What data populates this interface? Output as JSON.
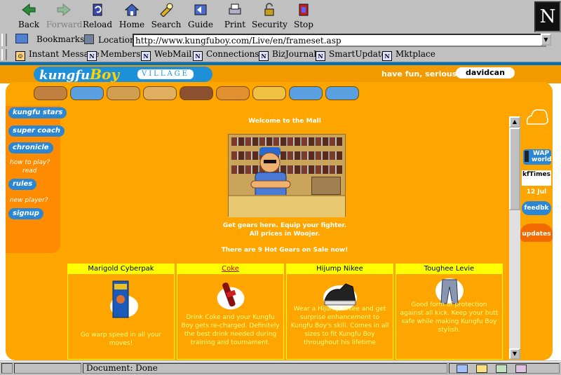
{
  "toolbar": {
    "buttons": [
      {
        "label": "Back",
        "icon": "back-arrow-icon"
      },
      {
        "label": "Forward",
        "icon": "forward-arrow-icon"
      },
      {
        "label": "Reload",
        "icon": "reload-icon"
      },
      {
        "label": "Home",
        "icon": "home-icon"
      },
      {
        "label": "Search",
        "icon": "search-flashlight-icon"
      },
      {
        "label": "Guide",
        "icon": "guide-icon"
      },
      {
        "label": "Print",
        "icon": "printer-icon"
      },
      {
        "label": "Security",
        "icon": "padlock-icon"
      },
      {
        "label": "Stop",
        "icon": "stop-icon"
      }
    ],
    "logo": "N"
  },
  "location": {
    "bookmarks_label": "Bookmarks",
    "label": "Location:",
    "url": "http://www.kungfuboy.com/Live/en/frameset.asp"
  },
  "personal": {
    "items": [
      "Instant Message",
      "Members",
      "WebMail",
      "Connections",
      "BizJournal",
      "SmartUpdate",
      "Mktplace"
    ]
  },
  "site": {
    "logo_text_1": "kungfu",
    "logo_text_2": "Boy",
    "logo_text_3": "VILLAGE",
    "slogan": "have fun, seriously",
    "sponsor": "davidcan",
    "nav": [
      "kungfu stars",
      "super coach",
      "chronicle",
      "rules",
      "signup"
    ],
    "nav_notes": [
      "how to play?",
      "read",
      "new player?"
    ],
    "welcome": "Welcome to the Mall",
    "tagline_1": "Get gears here. Equip your fighter.",
    "tagline_2": "All prices in Woojer.",
    "sale": "There are 9 Hot Gears on Sale now!",
    "products": [
      {
        "name": "Marigold Cyberpak",
        "desc": "Go warp speed in all your moves!"
      },
      {
        "name": "Coke",
        "desc": "Drink Coke and your Kungfu Boy gets re-charged. Definitely the best drink needed during training and tournament."
      },
      {
        "name": "Hijump Nikee",
        "desc": "Wear a Hijump Nikee and get surprise enhancement to Kungfu Boy's skill. Comes in all sizes to fit Kungfu Boy throughout his lifetime"
      },
      {
        "name": "Toughee Levie",
        "desc": "Good form of protection against all kick. Keep your butt safe while making Kungfu Boy stylish."
      }
    ],
    "right": {
      "wap": "WAP",
      "world": "world",
      "times": "kfTimes",
      "date": "12 Jul",
      "feedbk": "feedbk",
      "updates": "updates"
    }
  },
  "status": {
    "text": "Document: Done"
  },
  "colors": {
    "orange": "#ffa500",
    "blue": "#2b86d4",
    "yellow": "#ffff00"
  }
}
